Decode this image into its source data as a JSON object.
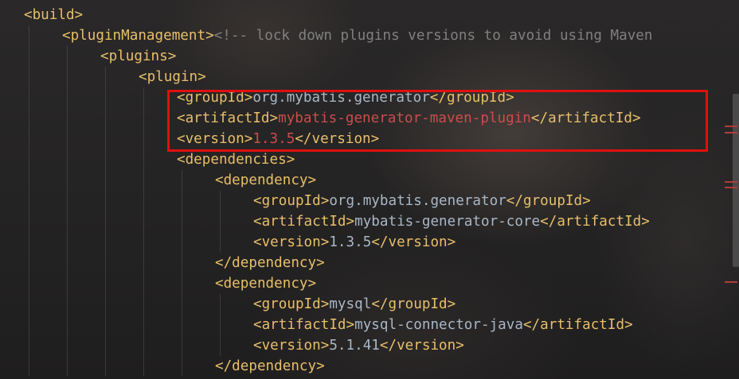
{
  "editor": {
    "lines": [
      {
        "indent": 0,
        "open": "<build>"
      },
      {
        "indent": 1,
        "open": "<pluginManagement>",
        "comment": "<!-- lock down plugins versions to avoid using Maven"
      },
      {
        "indent": 2,
        "open": "<plugins>"
      },
      {
        "indent": 3,
        "open": "<plugin>"
      },
      {
        "indent": 4,
        "open": "<groupId>",
        "value": "org.mybatis.generator",
        "close": "</groupId>"
      },
      {
        "indent": 4,
        "open": "<artifactId>",
        "value": "mybatis-generator-maven-plugin",
        "close": "</artifactId>",
        "value_color": "error"
      },
      {
        "indent": 4,
        "open": "<version>",
        "value": "1.3.5",
        "close": "</version>",
        "value_color": "error"
      },
      {
        "indent": 4,
        "open": "<dependencies>"
      },
      {
        "indent": 5,
        "open": "<dependency>"
      },
      {
        "indent": 6,
        "open": "<groupId>",
        "value": "org.mybatis.generator",
        "close": "</groupId>"
      },
      {
        "indent": 6,
        "open": "<artifactId>",
        "value": "mybatis-generator-core",
        "close": "</artifactId>"
      },
      {
        "indent": 6,
        "open": "<version>",
        "value": "1.3.5",
        "close": "</version>"
      },
      {
        "indent": 5,
        "open": "</dependency>"
      },
      {
        "indent": 5,
        "open": "<dependency>"
      },
      {
        "indent": 6,
        "open": "<groupId>",
        "value": "mysql",
        "close": "</groupId>"
      },
      {
        "indent": 6,
        "open": "<artifactId>",
        "value": "mysql-connector-java",
        "close": "</artifactId>"
      },
      {
        "indent": 6,
        "open": "<version>",
        "value": "5.1.41",
        "close": "</version>"
      },
      {
        "indent": 5,
        "open": "</dependency>"
      }
    ]
  },
  "colors": {
    "tag": "#e8bf6a",
    "text": "#a9b7c6",
    "error_text": "#cc4c4c",
    "comment": "#808080",
    "highlight_box": "#e10f0f"
  }
}
